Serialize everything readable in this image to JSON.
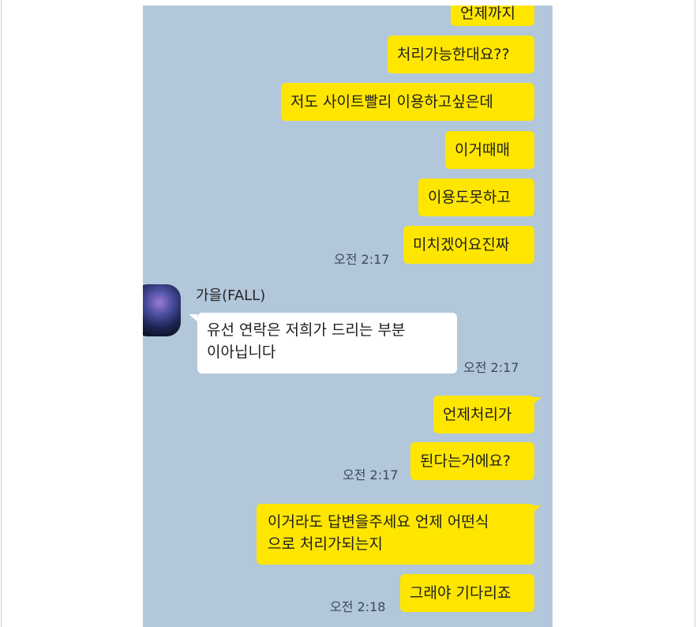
{
  "messages": {
    "m0": "언제까지",
    "m1": "처리가능한대요??",
    "m2": "저도 사이트빨리 이용하고싶은데",
    "m3": "이거때매",
    "m4": "이용도못하고",
    "m5": "미치겠어요진짜",
    "m6_line1": "유선 연락은 저희가 드리는 부분",
    "m6_line2": "이아닙니다",
    "m7": "언제처리가",
    "m8": "된다는거에요?",
    "m9_line1": "이거라도 답변을주세요 언제 어떤식",
    "m9_line2": "으로 처리가되는지",
    "m10": "그래야 기다리죠"
  },
  "times": {
    "t1": "오전 2:17",
    "t2": "오전 2:17",
    "t3": "오전 2:17",
    "t4": "오전 2:18"
  },
  "sender": {
    "name": "가을(FALL)",
    "avatar_icon": "profile-avatar"
  },
  "colors": {
    "chat_background": "#b2c7da",
    "my_bubble": "#fee600",
    "other_bubble": "#ffffff"
  }
}
